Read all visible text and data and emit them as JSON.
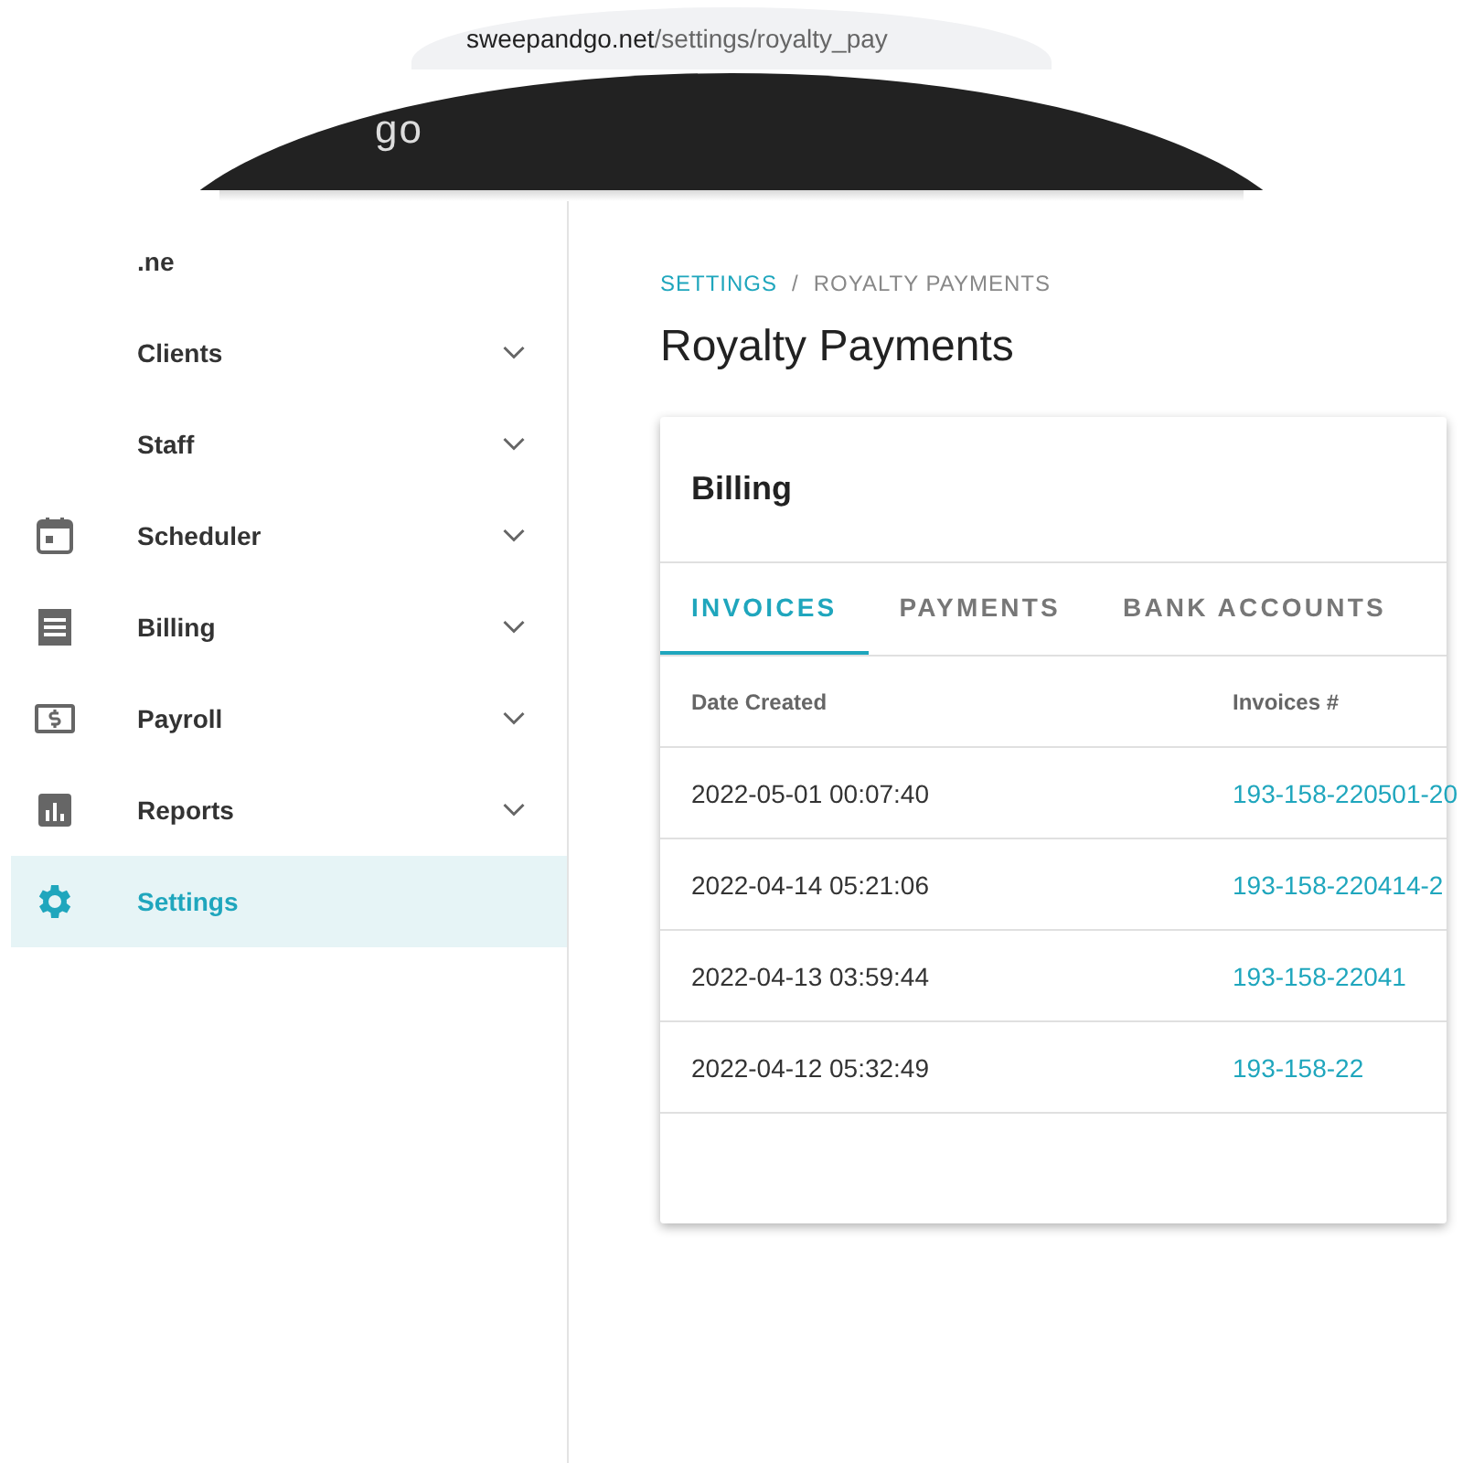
{
  "browser": {
    "url_host": "sweepandgo.net",
    "url_path": "/settings/royalty_pay"
  },
  "header": {
    "logo": "go"
  },
  "sidebar": {
    "items": [
      {
        "label": ".ne",
        "expandable": false,
        "selected": false
      },
      {
        "label": "Clients",
        "expandable": true,
        "selected": false
      },
      {
        "label": "Staff",
        "expandable": true,
        "selected": false
      },
      {
        "label": "Scheduler",
        "expandable": true,
        "selected": false
      },
      {
        "label": "Billing",
        "expandable": true,
        "selected": false
      },
      {
        "label": "Payroll",
        "expandable": true,
        "selected": false
      },
      {
        "label": "Reports",
        "expandable": true,
        "selected": false
      },
      {
        "label": "Settings",
        "expandable": false,
        "selected": true
      }
    ]
  },
  "breadcrumb": {
    "separator": "/",
    "items": [
      {
        "label": "SETTINGS",
        "link": true
      },
      {
        "label": "ROYALTY PAYMENTS",
        "link": false
      }
    ]
  },
  "page_title": "Royalty Payments",
  "card": {
    "title": "Billing",
    "tabs": [
      {
        "label": "INVOICES",
        "selected": true
      },
      {
        "label": "PAYMENTS",
        "selected": false
      },
      {
        "label": "BANK ACCOUNTS",
        "selected": false
      }
    ],
    "columns": [
      "Date Created",
      "Invoices #"
    ],
    "rows": [
      [
        "2022-05-01 00:07:40",
        "193-158-220501-20"
      ],
      [
        "2022-04-14 05:21:06",
        "193-158-220414-2"
      ],
      [
        "2022-04-13 03:59:44",
        "193-158-22041"
      ],
      [
        "2022-04-12 05:32:49",
        "193-158-22"
      ]
    ]
  }
}
